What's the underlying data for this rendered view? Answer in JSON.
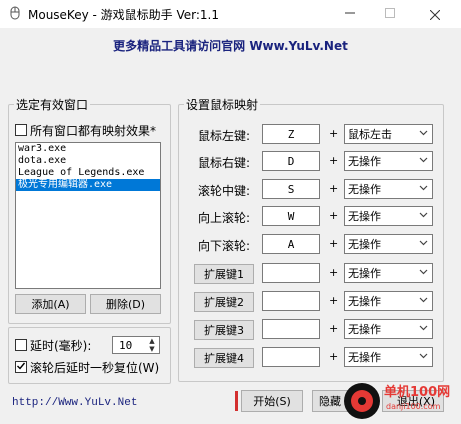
{
  "window": {
    "title": "MouseKey - 游戏鼠标助手 Ver:1.1",
    "slogan": "更多精品工具请访问官网 Www.YuLv.Net"
  },
  "left_panel": {
    "group_title": "选定有效窗口",
    "all_windows_label": "所有窗口都有映射效果*",
    "all_windows_checked": false,
    "processes": [
      "war3.exe",
      "dota.exe",
      "League of Legends.exe",
      "极光专用编辑器.exe"
    ],
    "selected_index": 3,
    "add_button": "添加(A)",
    "delete_button": "删除(D)",
    "delay_label": "延时(毫秒):",
    "delay_checked": false,
    "delay_value": "10",
    "reset_label": "滚轮后延时一秒复位(W)",
    "reset_checked": true
  },
  "right_panel": {
    "group_title": "设置鼠标映射",
    "rows": [
      {
        "label": "鼠标左键:",
        "key": "Z",
        "action": "鼠标左击"
      },
      {
        "label": "鼠标右键:",
        "key": "D",
        "action": "无操作"
      },
      {
        "label": "滚轮中键:",
        "key": "S",
        "action": "无操作"
      },
      {
        "label": "向上滚轮:",
        "key": "W",
        "action": "无操作"
      },
      {
        "label": "向下滚轮:",
        "key": "A",
        "action": "无操作"
      },
      {
        "label": "扩展键1",
        "key": "",
        "action": "无操作"
      },
      {
        "label": "扩展键2",
        "key": "",
        "action": "无操作"
      },
      {
        "label": "扩展键3",
        "key": "",
        "action": "无操作"
      },
      {
        "label": "扩展键4",
        "key": "",
        "action": "无操作"
      }
    ],
    "plus_sign": "+"
  },
  "footer": {
    "site": "http://Www.YuLv.Net",
    "start_button": "开始(S)",
    "hide_button": "隐藏",
    "exit_button": "退出(X)"
  },
  "watermark": {
    "text": "单机100网",
    "url": "danji100.com"
  },
  "icons": {
    "app": "mouse-icon",
    "minimize": "minimize-icon",
    "maximize": "maximize-icon",
    "close": "close-icon",
    "dropdown": "chevron-down-icon",
    "check": "checkmark-icon"
  },
  "colors": {
    "selection": "#0078d7",
    "slogan": "#1a237e",
    "link": "#1a237e",
    "watermark": "#e53935"
  }
}
